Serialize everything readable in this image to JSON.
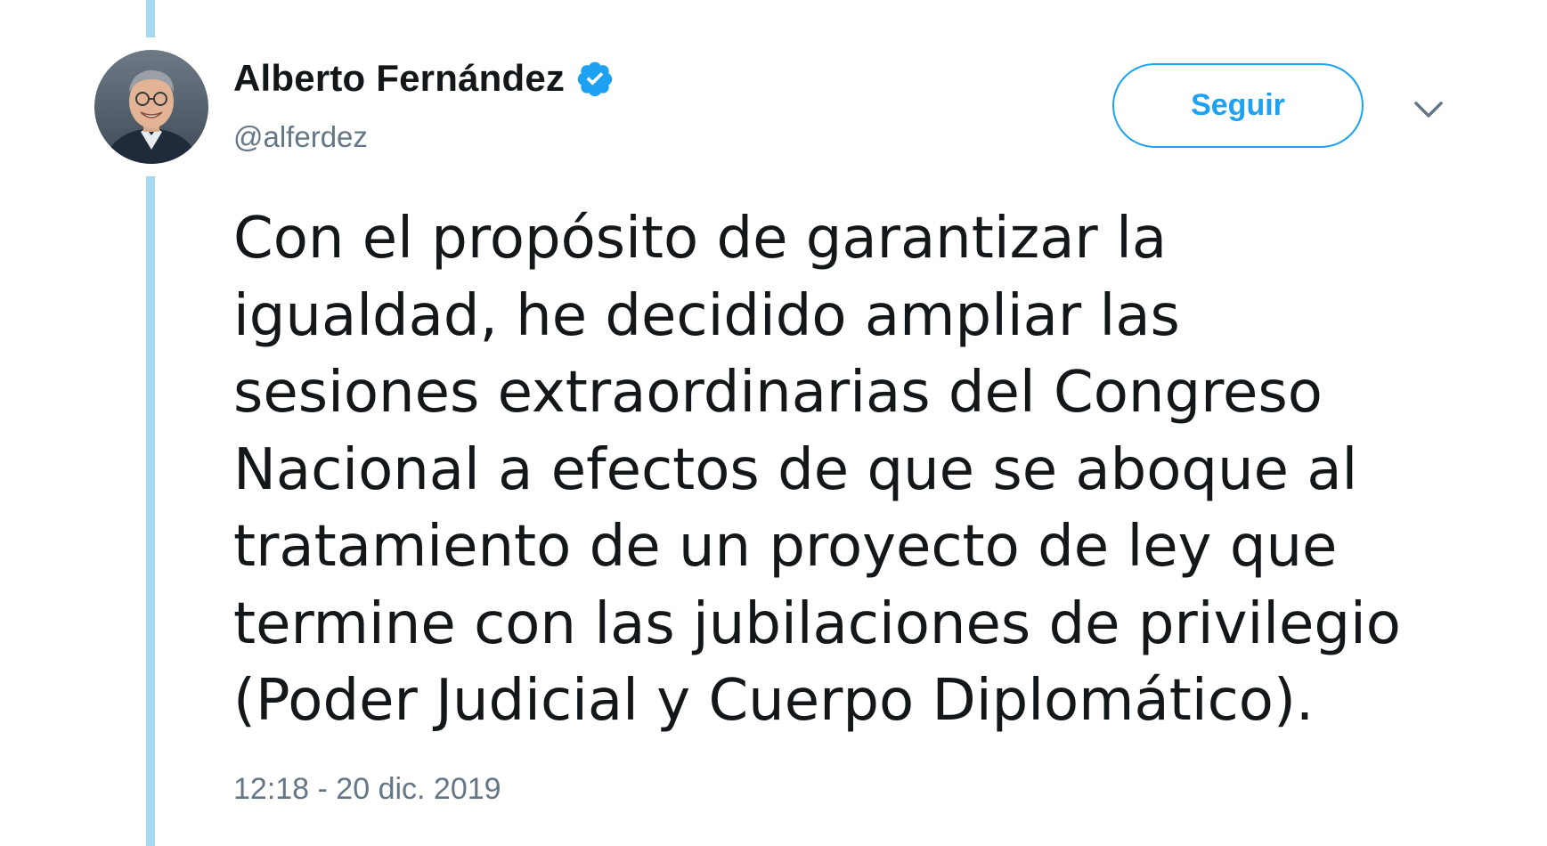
{
  "tweet": {
    "author": {
      "display_name": "Alberto Fernández",
      "handle": "@alferdez",
      "verified": true,
      "verified_icon": "verified-badge-icon",
      "avatar_icon": "avatar-photo"
    },
    "follow_button_label": "Seguir",
    "menu_icon": "chevron-down-icon",
    "text_lines": [
      "Con el propósito de garantizar la",
      "igualdad, he decidido ampliar las",
      "sesiones extraordinarias del Congreso",
      "Nacional a efectos de que se aboque al",
      "tratamiento de un proyecto de ley que",
      "termine con las jubilaciones de privilegio",
      "(Poder Judicial y Cuerpo Diplomático)."
    ],
    "timestamp": "12:18 - 20 dic. 2019"
  },
  "colors": {
    "accent": "#1da1f2",
    "thread_line": "#a4d9ef",
    "secondary_text": "#657786",
    "primary_text": "#14171a"
  }
}
